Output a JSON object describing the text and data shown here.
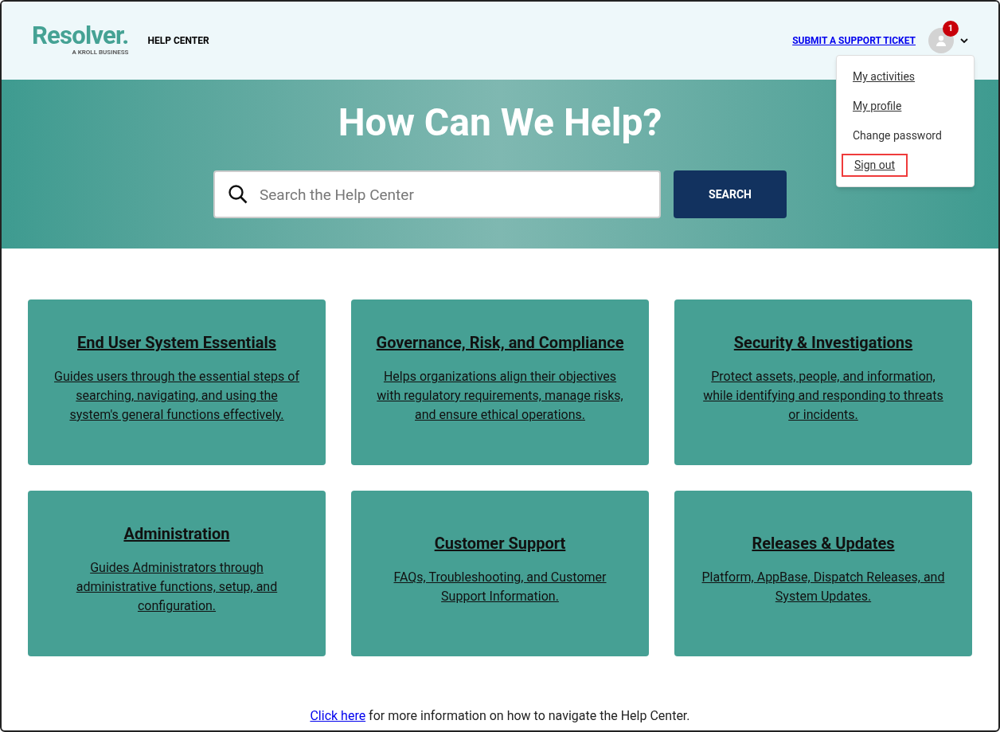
{
  "header": {
    "logo": {
      "name": "Resolver.",
      "tagline": "A KROLL BUSINESS"
    },
    "title": "HELP CENTER",
    "support_link": "SUBMIT A SUPPORT TICKET",
    "notification_count": "1"
  },
  "user_menu": {
    "expanded": true,
    "items": [
      {
        "label": "My activities",
        "underlined": true,
        "highlighted": false
      },
      {
        "label": "My profile",
        "underlined": true,
        "highlighted": false
      },
      {
        "label": "Change password",
        "underlined": false,
        "highlighted": false
      },
      {
        "label": "Sign out",
        "underlined": true,
        "highlighted": true
      }
    ]
  },
  "hero": {
    "heading": "How Can We Help?",
    "search": {
      "placeholder": "Search the Help Center"
    },
    "search_button": "SEARCH"
  },
  "categories": [
    {
      "title": "End User System Essentials",
      "description": "Guides users through the essential steps of searching, navigating, and using the system's general functions effectively."
    },
    {
      "title": "Governance, Risk, and Compliance",
      "description": "Helps organizations align their objectives with regulatory requirements, manage risks, and ensure ethical operations."
    },
    {
      "title": "Security & Investigations",
      "description": "Protect assets, people, and information, while identifying and responding to threats or incidents."
    },
    {
      "title": "Administration",
      "description": "Guides Administrators through administrative functions, setup, and configuration."
    },
    {
      "title": "Customer Support",
      "description": "FAQs, Troubleshooting, and Customer Support Information."
    },
    {
      "title": "Releases & Updates",
      "description": "Platform, AppBase, Dispatch Releases, and System Updates."
    }
  ],
  "footer": {
    "link": "Click here",
    "text": " for more information on how to navigate the Help Center."
  }
}
